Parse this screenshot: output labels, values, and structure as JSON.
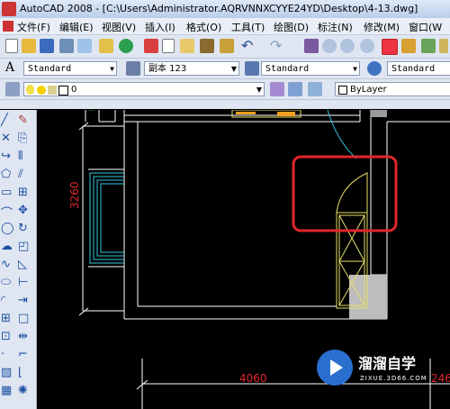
{
  "window": {
    "title": "AutoCAD 2008 - [C:\\Users\\Administrator.AQRVNNXCYYE24YD\\Desktop\\4-13.dwg]"
  },
  "menu": [
    "文件(F)",
    "编辑(E)",
    "视图(V)",
    "插入(I)",
    "格式(O)",
    "工具(T)",
    "绘图(D)",
    "标注(N)",
    "修改(M)",
    "窗口(W"
  ],
  "styles": {
    "text_style": "Standard",
    "dim_style": "副本 123",
    "table_style": "Standard",
    "multileader_style": "Standard"
  },
  "layer": {
    "current": "0",
    "color": "ByLayer"
  },
  "drawing": {
    "dim_vertical": "3260",
    "dim_horizontal": "4060",
    "dim_right_partial": "246"
  },
  "watermark": {
    "brand": "溜溜自学",
    "site": "ZIXUE.3D66.COM"
  },
  "colors": {
    "dim_text": "#e0262d",
    "highlight": "#e0262d",
    "door": "#e8e066",
    "window_frame": "#34c6e0"
  }
}
